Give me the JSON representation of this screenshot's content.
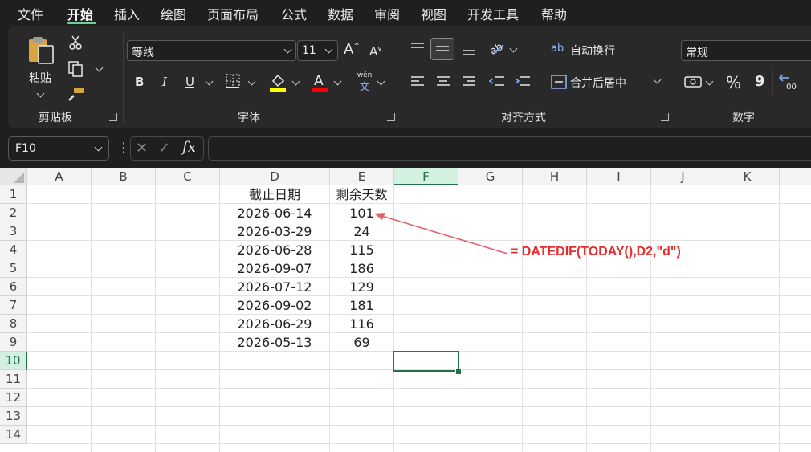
{
  "menu": {
    "items": [
      "文件",
      "开始",
      "插入",
      "绘图",
      "页面布局",
      "公式",
      "数据",
      "审阅",
      "视图",
      "开发工具",
      "帮助"
    ]
  },
  "ribbon": {
    "clipboard": {
      "paste_label": "粘贴",
      "group_label": "剪贴板"
    },
    "font": {
      "font_name": "等线",
      "font_size": "11",
      "group_label": "字体",
      "phonetic_top": "wén",
      "phonetic_bottom": "文",
      "bold": "B",
      "italic": "I",
      "underline": "U",
      "highlight_color": "#ffff00",
      "font_color": "#ff0000"
    },
    "alignment": {
      "wrap_label": "自动换行",
      "merge_label": "合并后居中",
      "group_label": "对齐方式"
    },
    "number": {
      "format": "常规",
      "group_label": "数字",
      "percent": "%",
      "comma": "9"
    }
  },
  "formula_bar": {
    "name_box": "F10",
    "fx_label": "fx",
    "formula": ""
  },
  "sheet": {
    "columns": [
      "A",
      "B",
      "C",
      "D",
      "E",
      "F",
      "G",
      "H",
      "I",
      "J",
      "K"
    ],
    "rows": [
      "1",
      "2",
      "3",
      "4",
      "5",
      "6",
      "7",
      "8",
      "9",
      "10",
      "11",
      "12",
      "13",
      "14"
    ],
    "selected_cell": "F10",
    "headers": {
      "D1": "截止日期",
      "E1": "剩余天数"
    },
    "data": [
      {
        "date": "2026-06-14",
        "days": "101"
      },
      {
        "date": "2026-03-29",
        "days": "24"
      },
      {
        "date": "2026-06-28",
        "days": "115"
      },
      {
        "date": "2026-09-07",
        "days": "186"
      },
      {
        "date": "2026-07-12",
        "days": "129"
      },
      {
        "date": "2026-09-02",
        "days": "181"
      },
      {
        "date": "2026-06-29",
        "days": "116"
      },
      {
        "date": "2026-05-13",
        "days": "69"
      }
    ],
    "annotation": "=  DATEDIF(TODAY(),D2,\"d\")",
    "annotation_color": "#e52d2d"
  },
  "colors": {
    "accent": "#217346",
    "menu_active": "#6fcf97"
  }
}
